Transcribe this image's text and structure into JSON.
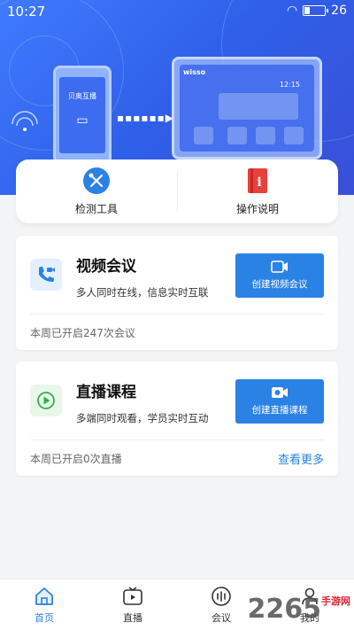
{
  "status": {
    "time": "10:27",
    "battery": "26",
    "battery_level": 0.26
  },
  "hero": {
    "phone_text": "贝奥互播",
    "tv_brand": "wisso",
    "tv_time": "12:15"
  },
  "tools": [
    {
      "label": "检测工具",
      "icon": "tools-icon"
    },
    {
      "label": "操作说明",
      "icon": "manual-book-icon"
    }
  ],
  "meeting": {
    "title": "视频会议",
    "desc": "多人同时在线，信息实时互联",
    "button": "创建视频会议",
    "stat": "本周已开启247次会议"
  },
  "live": {
    "title": "直播课程",
    "desc": "多端同时观看，学员实时互动",
    "button": "创建直播课程",
    "stat": "本周已开启0次直播",
    "more": "查看更多"
  },
  "nav": [
    {
      "label": "首页",
      "icon": "home-icon",
      "active": true
    },
    {
      "label": "直播",
      "icon": "tv-play-icon",
      "active": false
    },
    {
      "label": "会议",
      "icon": "meeting-icon",
      "active": false
    },
    {
      "label": "我的",
      "icon": "user-icon",
      "active": false
    }
  ],
  "watermark": {
    "text": "2265",
    "sub": "手游网"
  },
  "colors": {
    "accent": "#2a82e4",
    "hero": "#3f7bff"
  }
}
